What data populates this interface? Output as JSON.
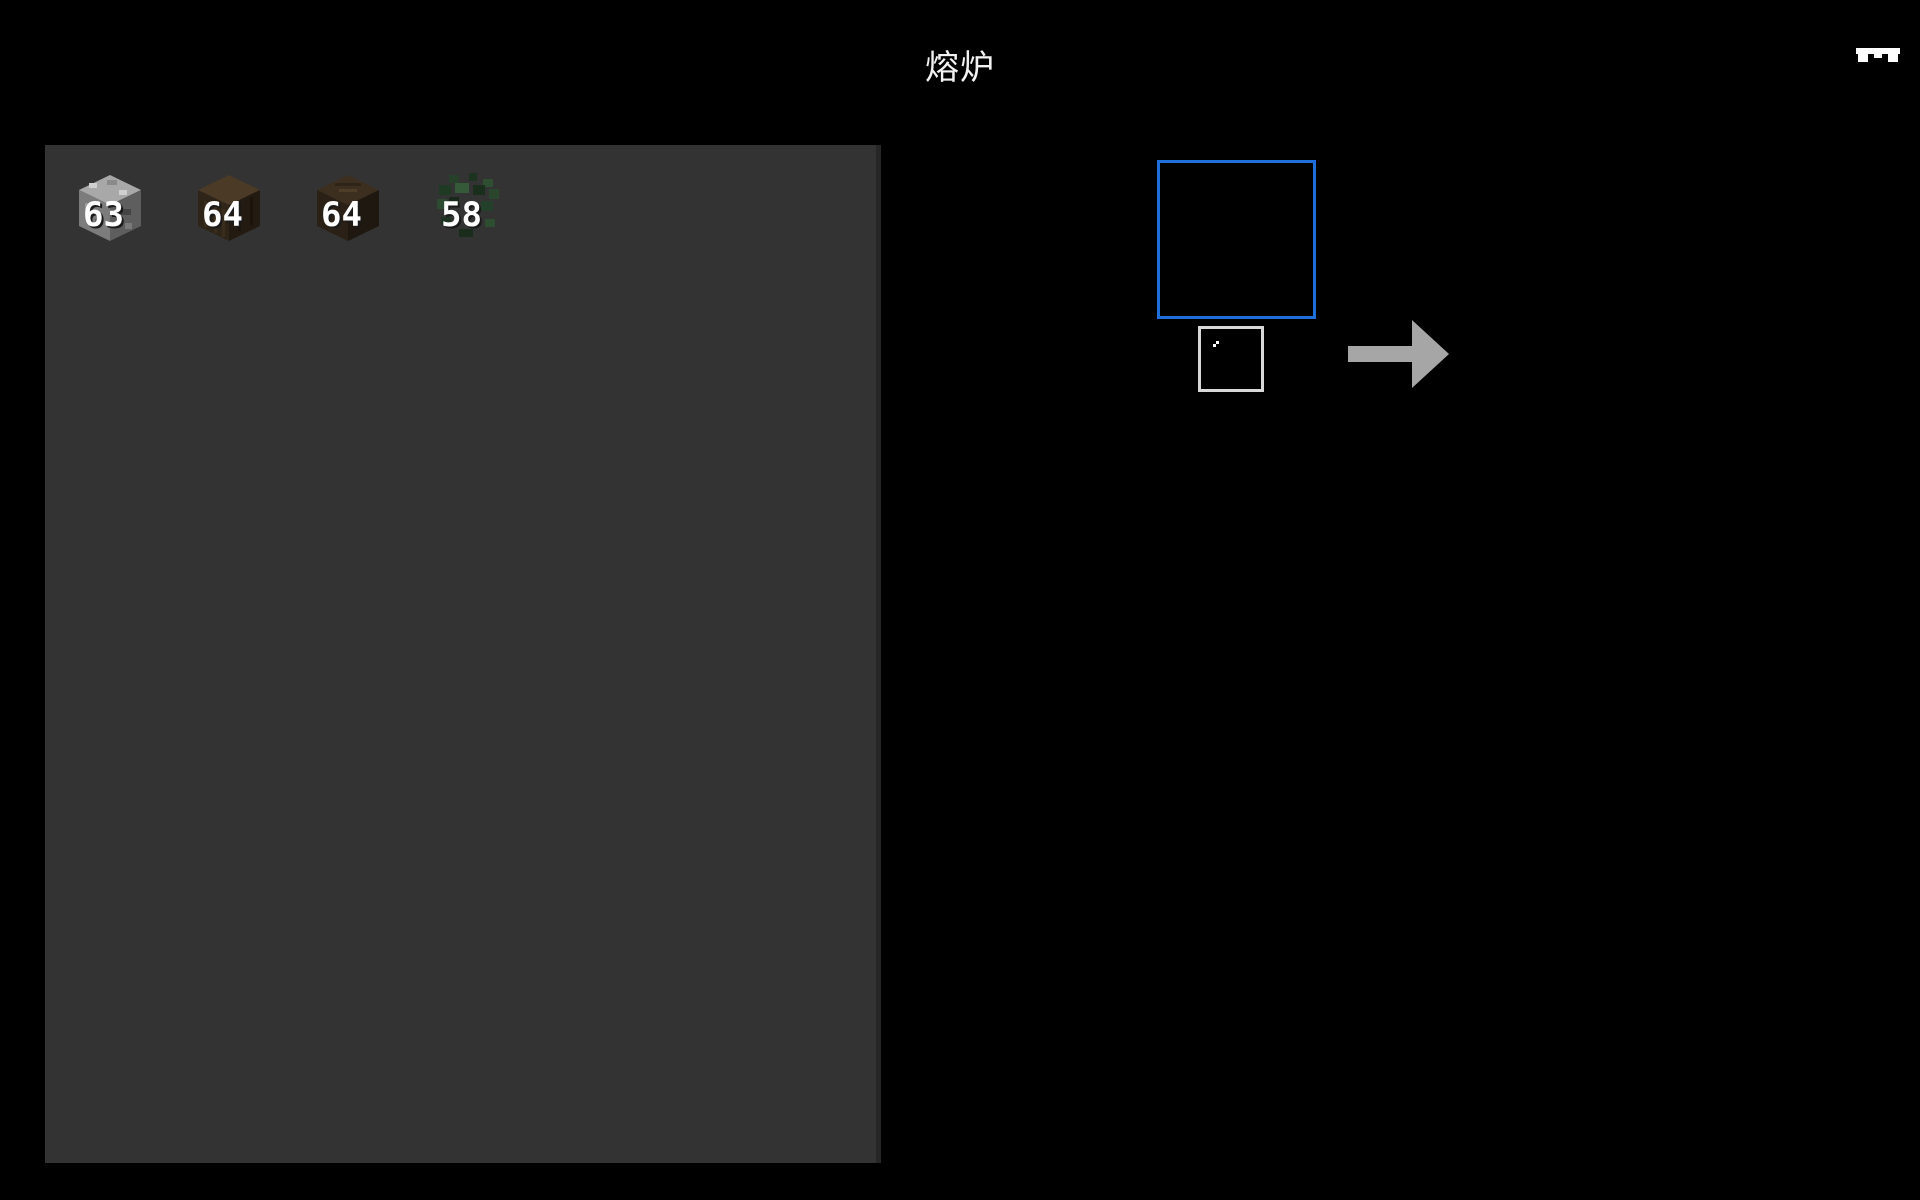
{
  "window": {
    "title": "熔炉"
  },
  "inventory": {
    "items": [
      {
        "icon": "cobblestone-block-icon",
        "count": "63"
      },
      {
        "icon": "dark-oak-log-block-icon",
        "count": "64"
      },
      {
        "icon": "dark-oak-log-block-icon",
        "count": "64"
      },
      {
        "icon": "leaves-block-icon",
        "count": "58"
      }
    ]
  },
  "furnace": {
    "input_slot": {
      "selected": true,
      "item": null
    },
    "fuel_slot": {
      "item": null
    },
    "progress": 0
  },
  "colors": {
    "background": "#000000",
    "inventory_panel": "#333333",
    "selected_slot_border": "#1e6fd9",
    "fuel_slot_border": "#d8d8d8",
    "arrow": "#a6a6a6"
  }
}
